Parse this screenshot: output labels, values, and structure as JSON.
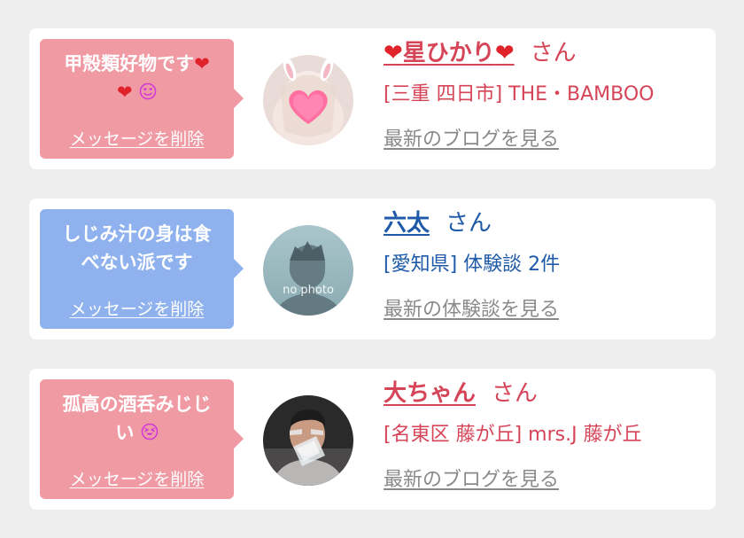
{
  "entries": [
    {
      "message_line1": "甲殻類好物です",
      "message_line2": "",
      "emoji_heart": "❤",
      "emoji_smile": "😍",
      "delete_label": "メッセージを削除",
      "name": "星ひかり",
      "name_prefix_icon": "❤",
      "name_suffix_icon": "❤",
      "honorific": "さん",
      "subtitle": "[三重 四日市] THE・BAMBOO",
      "link_label": "最新のブログを見る",
      "bubble_color": "#f09aa4",
      "name_color": "#d64458"
    },
    {
      "message_line1": "しじみ汁の身は食",
      "message_line2": "べない派です",
      "delete_label": "メッセージを削除",
      "name": "六太",
      "honorific": "さん",
      "subtitle": "[愛知県] 体験談 2件",
      "avatar_text": "no photo",
      "link_label": "最新の体験談を見る",
      "bubble_color": "#8fb2ee",
      "name_color": "#1f5aa8"
    },
    {
      "message_line1": "孤高の酒呑みじじ",
      "message_line2": "い",
      "emoji_smile": "😆",
      "delete_label": "メッセージを削除",
      "name": "大ちゃん",
      "honorific": "さん",
      "subtitle": "[名東区 藤が丘] mrs.J 藤が丘",
      "link_label": "最新のブログを見る",
      "bubble_color": "#f09aa4",
      "name_color": "#d64458"
    }
  ]
}
